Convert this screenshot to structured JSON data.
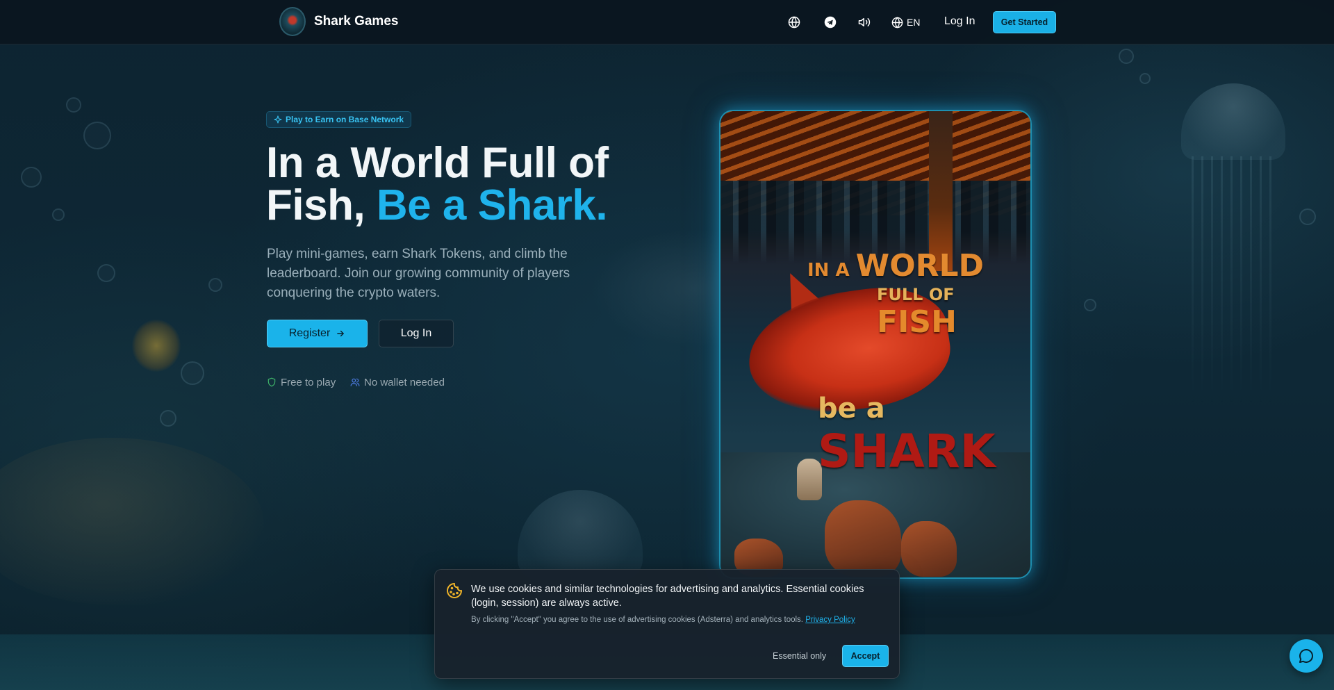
{
  "header": {
    "brand": "Shark Games",
    "language": "EN",
    "login_label": "Log In",
    "get_started_label": "Get Started",
    "icons": [
      "globe-icon",
      "telegram-icon",
      "volume-icon",
      "language-globe-icon"
    ]
  },
  "hero": {
    "badge": "Play to Earn on Base Network",
    "headline_line1": "In a World Full of",
    "headline_line2_plain": "Fish, ",
    "headline_line2_accent": "Be a Shark.",
    "subtext": "Play mini-games, earn Shark Tokens, and climb the leaderboard. Join our growing community of players conquering the crypto waters.",
    "register_label": "Register",
    "login_label": "Log In",
    "features": [
      {
        "label": "Free to play",
        "icon": "shield-icon",
        "color": "#3fb56a"
      },
      {
        "label": "No wallet needed",
        "icon": "users-icon",
        "color": "#4f7ee8"
      }
    ]
  },
  "poster": {
    "line1_small": "IN A",
    "line1_big": "WORLD",
    "line2_small": "FULL OF",
    "line2_big": "FISH",
    "line3_small": "be a",
    "line3_big": "SHARK"
  },
  "cookie": {
    "main_text": "We use cookies and similar technologies for advertising and analytics. Essential cookies (login, session) are always active.",
    "sub_text": "By clicking \"Accept\" you agree to the use of advertising cookies (Adsterra) and analytics tools. ",
    "privacy_link": "Privacy Policy",
    "essential_label": "Essential only",
    "accept_label": "Accept"
  },
  "colors": {
    "accent": "#1ab3ea",
    "header_bg": "#0a161e",
    "background": "#0c2230"
  }
}
